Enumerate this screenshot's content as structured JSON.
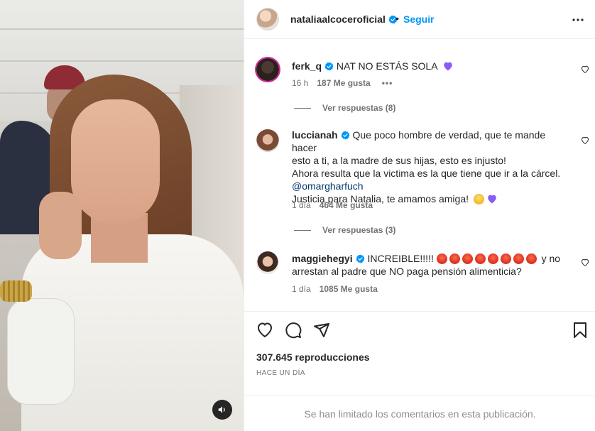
{
  "post": {
    "username": "nataliaalcoceroficial",
    "separator": "•",
    "follow_label": "Seguir",
    "more_icon": "more-horizontal-icon"
  },
  "comments": [
    {
      "username": "ferk_q",
      "verified": true,
      "text": "NAT NO ESTÁS SOLA",
      "emoji": "purple-heart",
      "time": "16 h",
      "likes": "187 Me gusta",
      "options": "•••",
      "replies_label": "Ver respuestas (8)"
    },
    {
      "username": "luccianah",
      "verified": true,
      "text_lines": [
        "Que poco hombre de verdad, que te mande hacer",
        "esto a ti, a la madre de sus hijas, esto es injusto!",
        "Ahora resulta que la victima es la que tiene que ir a la cárcel.",
        "@omargharfuch",
        "Justicia para Natalia, te amamos amiga!"
      ],
      "time": "1 día",
      "likes": "464 Me gusta",
      "replies_label": "Ver respuestas (3)"
    },
    {
      "username": "maggiehegyi",
      "verified": true,
      "text_start": "INCREIBLE!!!!!",
      "angry_emoji_count": 8,
      "text_end": "y no",
      "text_line2": "arrestan al padre que NO paga pensión alimenticia?",
      "time": "1 día",
      "likes": "1085 Me gusta"
    }
  ],
  "footer": {
    "views": "307.645 reproducciones",
    "time_ago": "HACE UN DÍA",
    "limited_notice": "Se han limitado los comentarios en esta publicación."
  },
  "colors": {
    "link_blue": "#0095f6",
    "verified_blue": "#0095f6",
    "mention_blue": "#00376b",
    "muted_gray": "#737373",
    "purple_heart": "#8a5cf6"
  }
}
